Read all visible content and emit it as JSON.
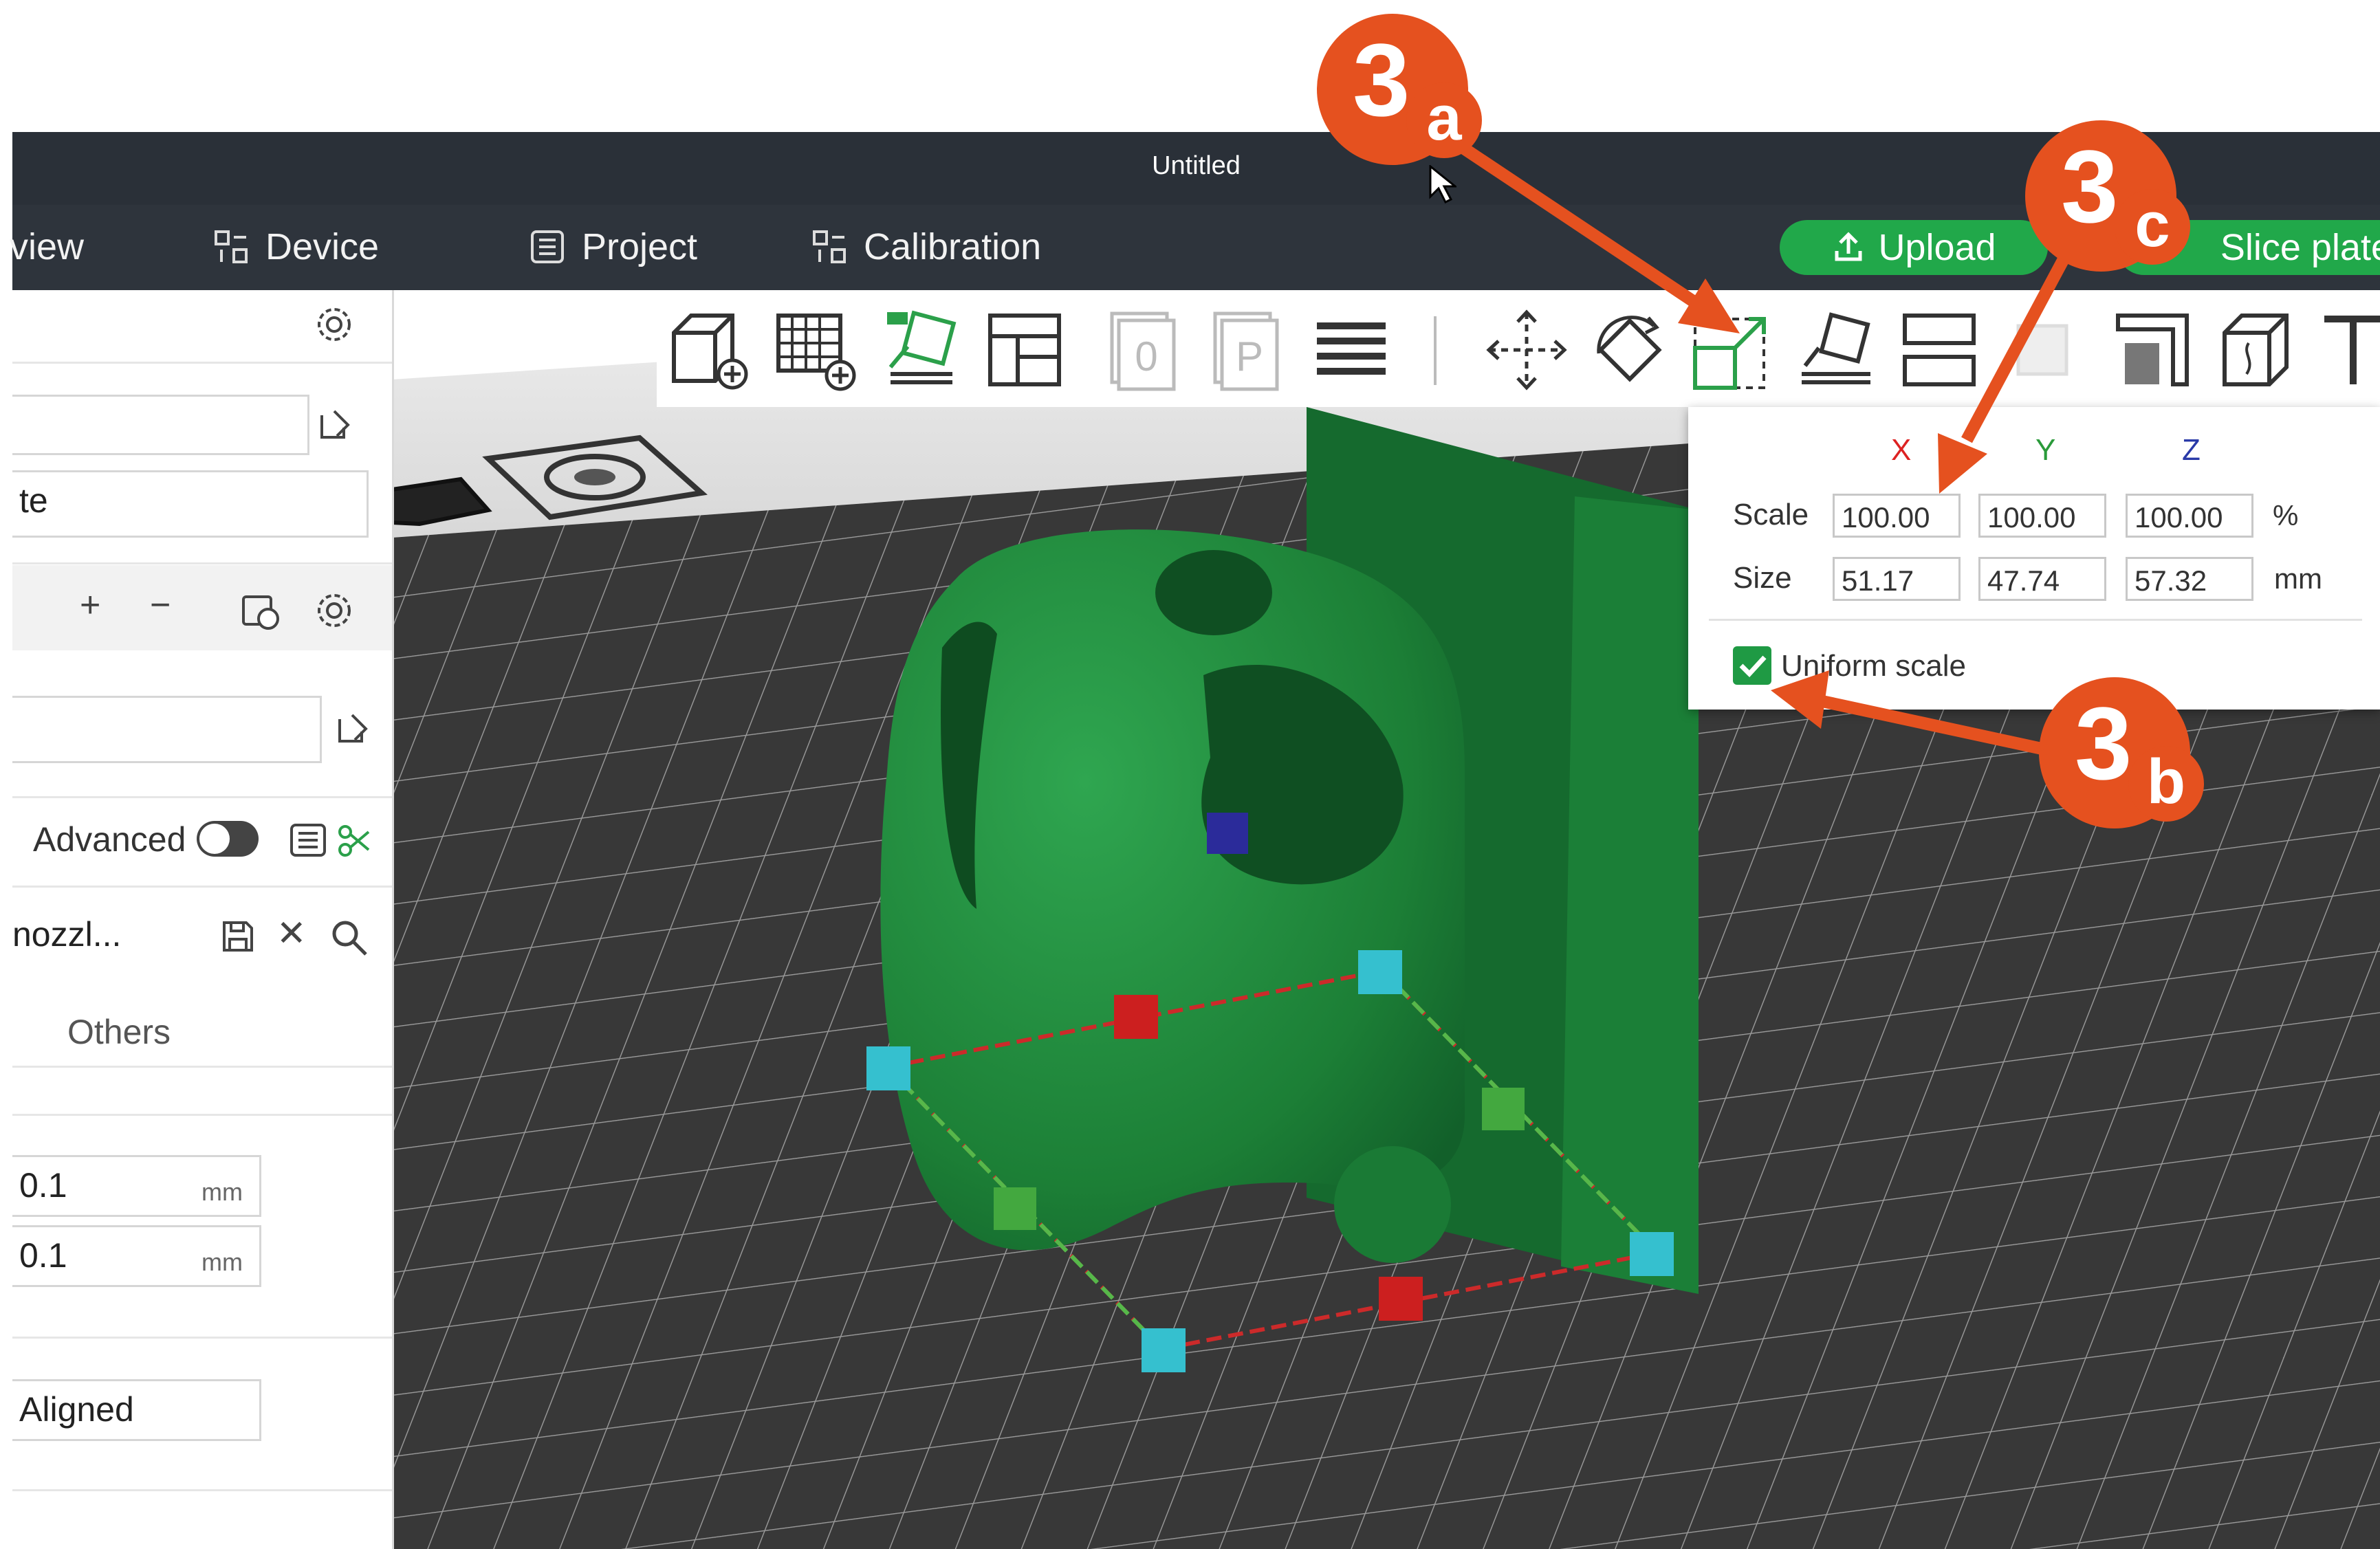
{
  "window": {
    "title": "Untitled"
  },
  "menu": {
    "preview_partial": "view",
    "device": "Device",
    "project": "Project",
    "calibration": "Calibration",
    "upload": "Upload",
    "slice_partial": "Slice plate"
  },
  "sidebar": {
    "field2_partial": "te",
    "advanced_label": "Advanced",
    "advanced_on": false,
    "preset_partial": "nozzl...",
    "tab_others": "Others",
    "value1_partial": "0.1",
    "value1_unit": "mm",
    "value2_partial": "0.1",
    "value2_unit": "mm",
    "select_partial": "Aligned"
  },
  "scale_panel": {
    "axis_x": "X",
    "axis_y": "Y",
    "axis_z": "Z",
    "scale_label": "Scale",
    "scale_x": "100.00",
    "scale_y": "100.00",
    "scale_z": "100.00",
    "scale_unit": "%",
    "size_label": "Size",
    "size_x": "51.17",
    "size_y": "47.74",
    "size_z": "57.32",
    "size_unit": "mm",
    "uniform_label": "Uniform scale",
    "uniform_checked": true
  },
  "annotations": [
    {
      "num": "3",
      "sub": "a"
    },
    {
      "num": "3",
      "sub": "b"
    },
    {
      "num": "3",
      "sub": "c"
    }
  ],
  "colors": {
    "accent_green": "#21a84a",
    "model_green": "#1f8a3c",
    "annotation_orange": "#e5511f",
    "bed_dark": "#3a3a3a"
  }
}
